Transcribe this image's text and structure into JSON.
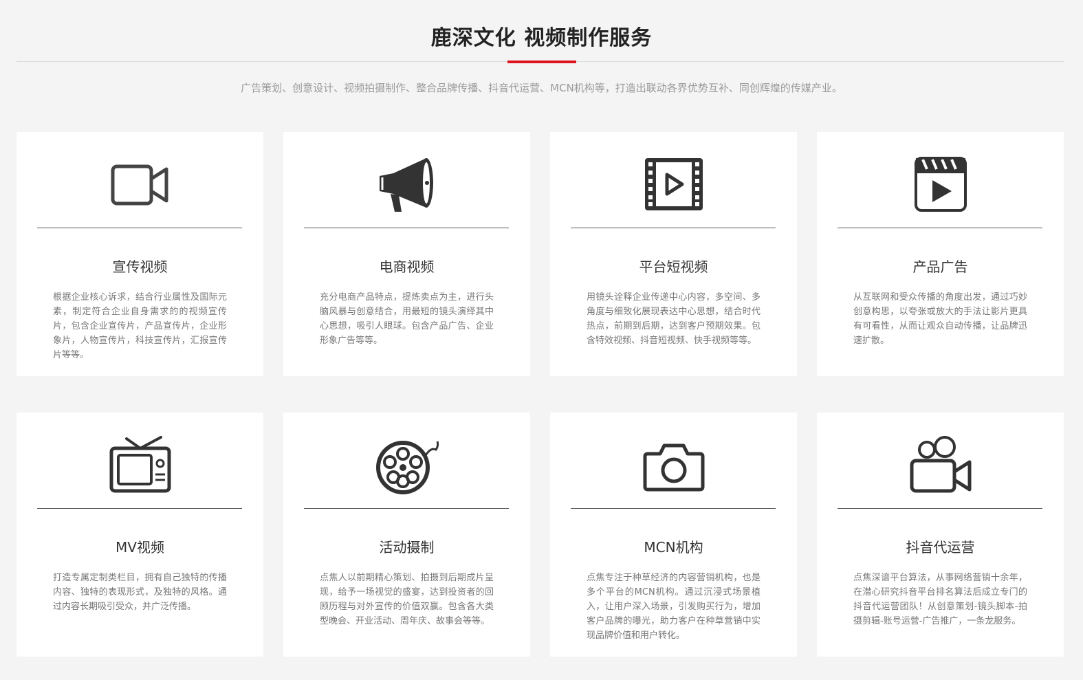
{
  "header": {
    "title": "鹿深文化 视频制作服务",
    "subtitle": "广告策划、创意设计、视频拍摄制作、整合品牌传播、抖音代运营、MCN机构等，打造出联动各界优势互补、同创辉煌的传媒产业。",
    "accent_color": "#e0121e"
  },
  "cards": [
    {
      "icon": "video-camera-icon",
      "title": "宣传视频",
      "desc": "根据企业核心诉求，结合行业属性及国际元素，制定符合企业自身需求的的视频宣传片，包含企业宣传片，产品宣传片，企业形象片，人物宣传片，科技宣传片，汇报宣传片等等。"
    },
    {
      "icon": "megaphone-icon",
      "title": "电商视频",
      "desc": "充分电商产品特点，提炼卖点为主，进行头脑风暴与创意结合，用最短的镜头演绎其中心思想，吸引人眼球。包含产品广告、企业形象广告等等。"
    },
    {
      "icon": "film-play-icon",
      "title": "平台短视频",
      "desc": "用镜头诠释企业传递中心内容，多空间、多角度与细致化展现表达中心思想，结合时代热点，前期到后期，达到客户预期效果。包含特效视频、抖音短视频、快手视频等等。"
    },
    {
      "icon": "clapperboard-icon",
      "title": "产品广告",
      "desc": "从互联网和受众传播的角度出发，通过巧妙创意构思，以夸张或放大的手法让影片更具有可看性，从而让观众自动传播，让品牌迅速扩散。"
    },
    {
      "icon": "tv-icon",
      "title": "MV视频",
      "desc": "打造专属定制类栏目，拥有自己独特的传播内容、独特的表现形式，及独特的风格。通过内容长期吸引受众，并广泛传播。"
    },
    {
      "icon": "film-reel-icon",
      "title": "活动摄制",
      "desc": "点焦人以前期精心策划、拍摄到后期成片呈现，给予一场视觉的盛宴，达到投资者的回顾历程与对外宣传的价值双赢。包含各大类型晚会、开业活动、周年庆、故事会等等。"
    },
    {
      "icon": "camera-icon",
      "title": "MCN机构",
      "desc": "点焦专注于种草经济的内容营销机构，也是多个平台的MCN机构。通过沉浸式场景植入，让用户深入场景，引发购买行为，增加客户品牌的曝光，助力客户在种草营销中实现品牌价值和用户转化。"
    },
    {
      "icon": "movie-camera-icon",
      "title": "抖音代运营",
      "desc": "点焦深谙平台算法，从事网络营销十余年，在潜心研究抖音平台排名算法后成立专门的抖音代运营团队！从创意策划-镜头脚本-拍摄剪辑-账号运营-广告推广，一条龙服务。"
    }
  ]
}
